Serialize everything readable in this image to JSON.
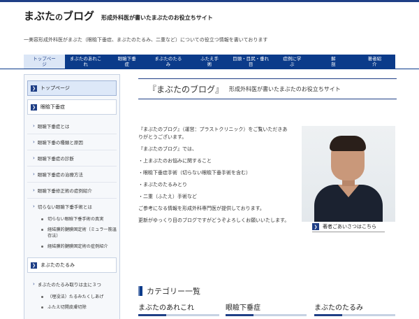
{
  "brand": {
    "title_main": "まぶた",
    "title_mid": "の",
    "title_end": "ブログ",
    "tagline": "形成外科医が書いたまぶたのお役立ちサイト"
  },
  "subtext": "一美容形成外科医がまぶた（眼瞼下垂症、まぶたのたるみ、二重など）についての役立つ情報を書いております",
  "nav": [
    {
      "label": "トップペー\nジ"
    },
    {
      "label": "まぶたのあれこ\nれ"
    },
    {
      "label": "眼瞼下垂\n症"
    },
    {
      "label": "まぶたのたる\nみ"
    },
    {
      "label": "ふたえ手\n術"
    },
    {
      "label": "目頭・目尻・垂れ\n目"
    },
    {
      "label": "症例に学\nぶ"
    },
    {
      "label": "解\n剖"
    },
    {
      "label": "著者紹\n介"
    }
  ],
  "sidebar": {
    "top": "トップページ",
    "head1": "眼瞼下垂症",
    "items": [
      "眼瞼下垂症とは",
      "眼瞼下垂の種類と原因",
      "眼瞼下垂症の診断",
      "眼瞼下垂症の治療方法",
      "眼瞼下垂修正術の症例紹介",
      "切らない眼瞼下垂手術とは"
    ],
    "subs": [
      "切らない眼瞼下垂手術の真実",
      "経結膜的腱膜固定術（ミュラー筋温存法）",
      "経結膜的腱膜固定術の症例紹介"
    ],
    "head2": "まぶたのたるみ",
    "items2": [
      "まぶたのたるみ取りは主に３つ"
    ],
    "subs2": [
      "（埋没法）たるみたくしあげ",
      "ふたえ切開皮膚切除"
    ]
  },
  "main": {
    "title_big": "『まぶたのブログ』",
    "title_small": "形成外科医が書いたまぶたのお役立ちサイト",
    "paragraphs": [
      "『まぶたのブログ』（運営：プラストクリニック）をご覧いただきありがとうございます。",
      "『まぶたのブログ』では、",
      "・上まぶたのお悩みに関すること",
      "・眼瞼下垂症手術（切らない眼瞼下垂手術を含む）",
      "・まぶたのたるみとり",
      "・二重（ふたえ）手術など",
      "ご参考になる情報を形成外科専門医が提供しております。",
      "更新がゆっくり目のブログですがどうぞよろしくお願いいたします。"
    ],
    "caption": "著者ごあいさつはこちら"
  },
  "categories": {
    "title": "カテゴリー一覧",
    "cols": [
      "まぶたのあれこれ",
      "眼瞼下垂症",
      "まぶたのたるみ"
    ]
  },
  "colors": {
    "primary": "#0b3b8a",
    "accent": "#dbe6f6"
  }
}
